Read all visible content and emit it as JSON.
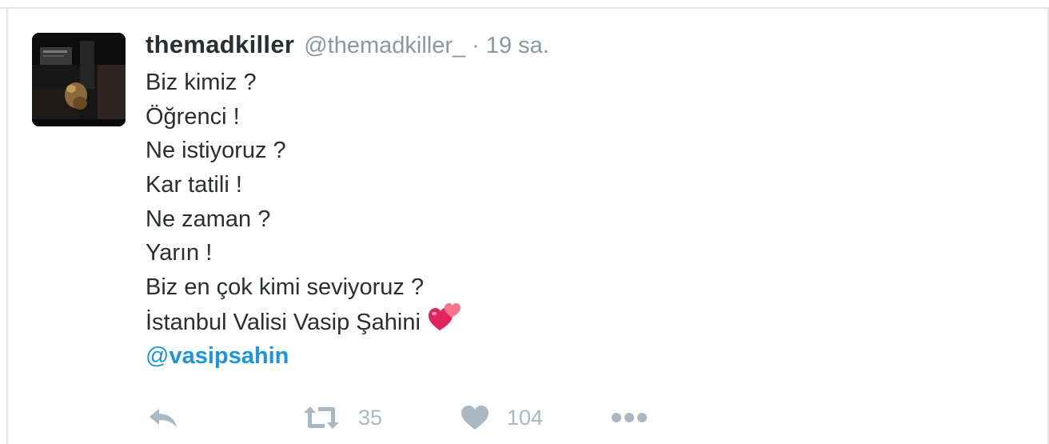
{
  "tweet": {
    "display_name": "themadkiller",
    "handle": "@themadkiller_",
    "separator": "·",
    "timestamp": "19 sa.",
    "lines": [
      "Biz kimiz ?",
      "Öğrenci !",
      "Ne istiyoruz ?",
      "Kar tatili !",
      "Ne zaman ?",
      "Yarın !",
      "Biz en çok kimi seviyoruz ?",
      "İstanbul Valisi Vasip Şahini"
    ],
    "emoji": "two-hearts-icon",
    "mention": {
      "at": "@",
      "name": "vasipsahin"
    }
  },
  "actions": {
    "reply_icon": "reply-icon",
    "retweet_icon": "retweet-icon",
    "retweet_count": "35",
    "like_icon": "heart-icon",
    "like_count": "104",
    "more_icon": "more-icon"
  },
  "colors": {
    "text": "#292f33",
    "muted": "#8899a6",
    "link": "#1b95e0",
    "action": "#aab8c2",
    "border": "#e1e8ed",
    "emoji_pink": "#e0245e"
  }
}
